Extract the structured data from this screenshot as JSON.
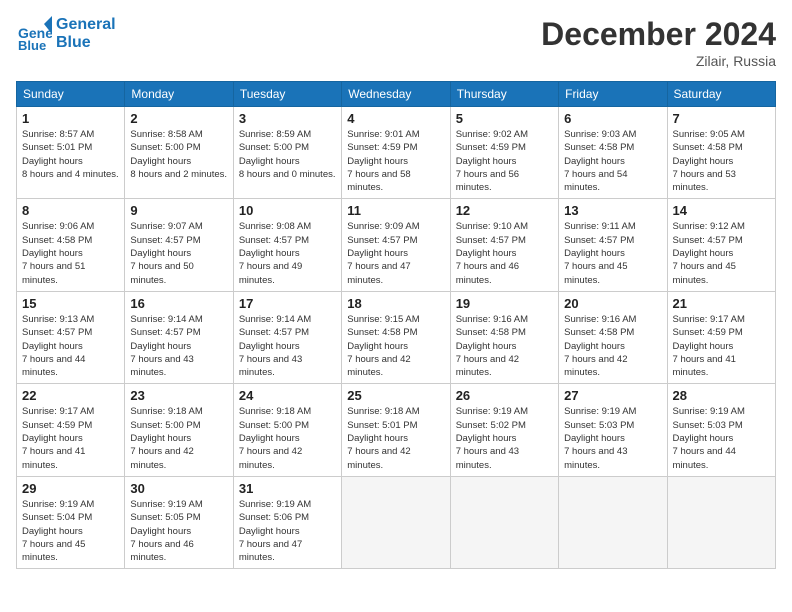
{
  "header": {
    "logo_line1": "General",
    "logo_line2": "Blue",
    "month": "December 2024",
    "location": "Zilair, Russia"
  },
  "weekdays": [
    "Sunday",
    "Monday",
    "Tuesday",
    "Wednesday",
    "Thursday",
    "Friday",
    "Saturday"
  ],
  "weeks": [
    [
      {
        "day": "1",
        "sunrise": "8:57 AM",
        "sunset": "5:01 PM",
        "daylight": "8 hours and 4 minutes."
      },
      {
        "day": "2",
        "sunrise": "8:58 AM",
        "sunset": "5:00 PM",
        "daylight": "8 hours and 2 minutes."
      },
      {
        "day": "3",
        "sunrise": "8:59 AM",
        "sunset": "5:00 PM",
        "daylight": "8 hours and 0 minutes."
      },
      {
        "day": "4",
        "sunrise": "9:01 AM",
        "sunset": "4:59 PM",
        "daylight": "7 hours and 58 minutes."
      },
      {
        "day": "5",
        "sunrise": "9:02 AM",
        "sunset": "4:59 PM",
        "daylight": "7 hours and 56 minutes."
      },
      {
        "day": "6",
        "sunrise": "9:03 AM",
        "sunset": "4:58 PM",
        "daylight": "7 hours and 54 minutes."
      },
      {
        "day": "7",
        "sunrise": "9:05 AM",
        "sunset": "4:58 PM",
        "daylight": "7 hours and 53 minutes."
      }
    ],
    [
      {
        "day": "8",
        "sunrise": "9:06 AM",
        "sunset": "4:58 PM",
        "daylight": "7 hours and 51 minutes."
      },
      {
        "day": "9",
        "sunrise": "9:07 AM",
        "sunset": "4:57 PM",
        "daylight": "7 hours and 50 minutes."
      },
      {
        "day": "10",
        "sunrise": "9:08 AM",
        "sunset": "4:57 PM",
        "daylight": "7 hours and 49 minutes."
      },
      {
        "day": "11",
        "sunrise": "9:09 AM",
        "sunset": "4:57 PM",
        "daylight": "7 hours and 47 minutes."
      },
      {
        "day": "12",
        "sunrise": "9:10 AM",
        "sunset": "4:57 PM",
        "daylight": "7 hours and 46 minutes."
      },
      {
        "day": "13",
        "sunrise": "9:11 AM",
        "sunset": "4:57 PM",
        "daylight": "7 hours and 45 minutes."
      },
      {
        "day": "14",
        "sunrise": "9:12 AM",
        "sunset": "4:57 PM",
        "daylight": "7 hours and 45 minutes."
      }
    ],
    [
      {
        "day": "15",
        "sunrise": "9:13 AM",
        "sunset": "4:57 PM",
        "daylight": "7 hours and 44 minutes."
      },
      {
        "day": "16",
        "sunrise": "9:14 AM",
        "sunset": "4:57 PM",
        "daylight": "7 hours and 43 minutes."
      },
      {
        "day": "17",
        "sunrise": "9:14 AM",
        "sunset": "4:57 PM",
        "daylight": "7 hours and 43 minutes."
      },
      {
        "day": "18",
        "sunrise": "9:15 AM",
        "sunset": "4:58 PM",
        "daylight": "7 hours and 42 minutes."
      },
      {
        "day": "19",
        "sunrise": "9:16 AM",
        "sunset": "4:58 PM",
        "daylight": "7 hours and 42 minutes."
      },
      {
        "day": "20",
        "sunrise": "9:16 AM",
        "sunset": "4:58 PM",
        "daylight": "7 hours and 42 minutes."
      },
      {
        "day": "21",
        "sunrise": "9:17 AM",
        "sunset": "4:59 PM",
        "daylight": "7 hours and 41 minutes."
      }
    ],
    [
      {
        "day": "22",
        "sunrise": "9:17 AM",
        "sunset": "4:59 PM",
        "daylight": "7 hours and 41 minutes."
      },
      {
        "day": "23",
        "sunrise": "9:18 AM",
        "sunset": "5:00 PM",
        "daylight": "7 hours and 42 minutes."
      },
      {
        "day": "24",
        "sunrise": "9:18 AM",
        "sunset": "5:00 PM",
        "daylight": "7 hours and 42 minutes."
      },
      {
        "day": "25",
        "sunrise": "9:18 AM",
        "sunset": "5:01 PM",
        "daylight": "7 hours and 42 minutes."
      },
      {
        "day": "26",
        "sunrise": "9:19 AM",
        "sunset": "5:02 PM",
        "daylight": "7 hours and 43 minutes."
      },
      {
        "day": "27",
        "sunrise": "9:19 AM",
        "sunset": "5:03 PM",
        "daylight": "7 hours and 43 minutes."
      },
      {
        "day": "28",
        "sunrise": "9:19 AM",
        "sunset": "5:03 PM",
        "daylight": "7 hours and 44 minutes."
      }
    ],
    [
      {
        "day": "29",
        "sunrise": "9:19 AM",
        "sunset": "5:04 PM",
        "daylight": "7 hours and 45 minutes."
      },
      {
        "day": "30",
        "sunrise": "9:19 AM",
        "sunset": "5:05 PM",
        "daylight": "7 hours and 46 minutes."
      },
      {
        "day": "31",
        "sunrise": "9:19 AM",
        "sunset": "5:06 PM",
        "daylight": "7 hours and 47 minutes."
      },
      null,
      null,
      null,
      null
    ]
  ]
}
